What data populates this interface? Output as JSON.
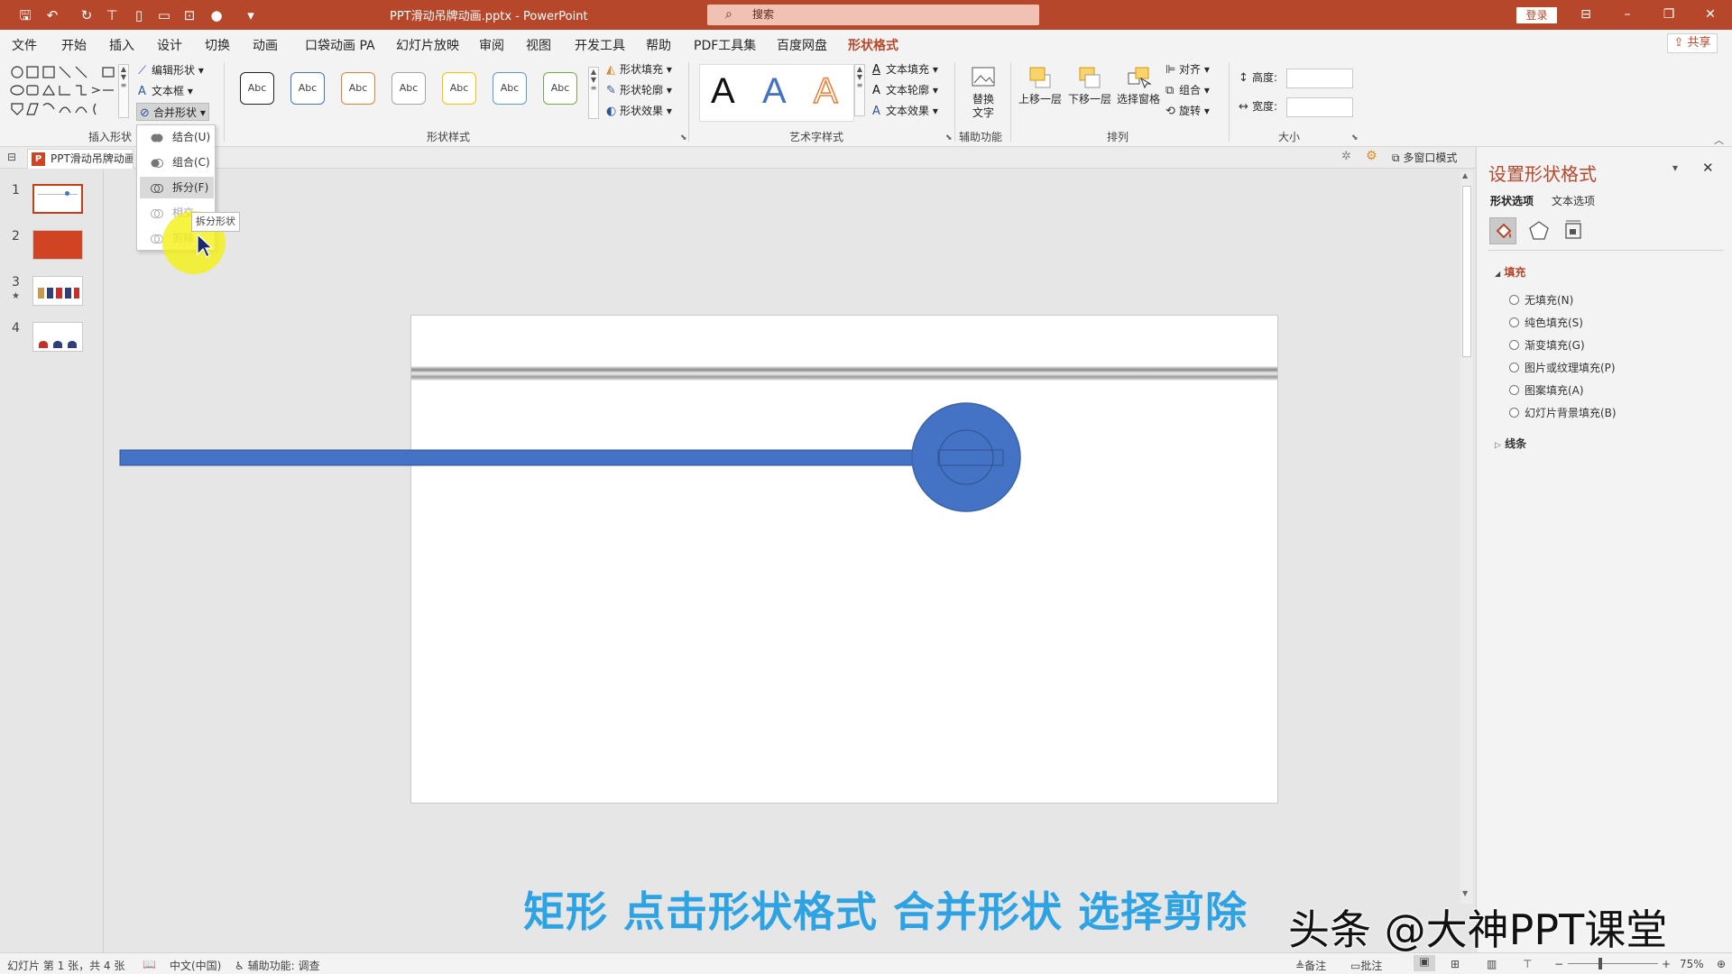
{
  "title_bar": {
    "doc_title": "PPT滑动吊牌动画.pptx  -  PowerPoint",
    "search_placeholder": "搜索",
    "login": "登录"
  },
  "tabs": [
    "文件",
    "开始",
    "插入",
    "设计",
    "切换",
    "动画",
    "口袋动画 PA",
    "幻灯片放映",
    "审阅",
    "视图",
    "开发工具",
    "帮助",
    "PDF工具集",
    "百度网盘",
    "形状格式"
  ],
  "active_tab": "形状格式",
  "share": "共享",
  "ribbon": {
    "insert_shapes": {
      "edit_shape": "编辑形状",
      "text_box": "文本框",
      "merge_shapes": "合并形状",
      "label": "插入形状"
    },
    "shape_styles": {
      "swatch_text": "Abc",
      "fill": "形状填充",
      "outline": "形状轮廓",
      "effects": "形状效果",
      "label": "形状样式"
    },
    "art_styles": {
      "letter": "A",
      "text_fill": "文本填充",
      "text_outline": "文本轮廓",
      "text_effects": "文本效果",
      "label": "艺术字样式"
    },
    "accessibility": {
      "alt_text_l1": "替换",
      "alt_text_l2": "文字",
      "label": "辅助功能"
    },
    "arrange": {
      "bring_forward": "上移一层",
      "send_backward": "下移一层",
      "selection_pane": "选择窗格",
      "align": "对齐",
      "group": "组合",
      "rotate": "旋转",
      "label": "排列"
    },
    "size": {
      "height": "高度:",
      "width": "宽度:",
      "label": "大小"
    }
  },
  "dropdown": {
    "items": [
      {
        "label": "结合(U)",
        "state": "normal"
      },
      {
        "label": "组合(C)",
        "state": "normal"
      },
      {
        "label": "拆分(F)",
        "state": "highlighted"
      },
      {
        "label": "相交",
        "state": "disabled"
      },
      {
        "label": "剪除",
        "state": "disabled"
      }
    ],
    "tooltip": "拆分形状"
  },
  "doc_tab": "PPT滑动吊牌动画",
  "multi_window": "多窗口模式",
  "thumbnails": [
    "1",
    "2",
    "3",
    "4"
  ],
  "format_pane": {
    "title": "设置形状格式",
    "tab_shape": "形状选项",
    "tab_text": "文本选项",
    "fill_section": "填充",
    "fill_options": [
      "无填充(N)",
      "纯色填充(S)",
      "渐变填充(G)",
      "图片或纹理填充(P)",
      "图案填充(A)",
      "幻灯片背景填充(B)"
    ],
    "line_section": "线条"
  },
  "status": {
    "slide": "幻灯片 第 1 张，共 4 张",
    "lang": "中文(中国)",
    "accessibility": "辅助功能: 调查",
    "notes": "备注",
    "comments": "批注",
    "zoom": "75%"
  },
  "caption": "矩形 点击形状格式 合并形状 选择剪除",
  "watermark": "头条 @大神PPT课堂",
  "colors": {
    "accent": "#b7472a",
    "shape_blue": "#4472c4",
    "caption": "#2ea3e3"
  }
}
